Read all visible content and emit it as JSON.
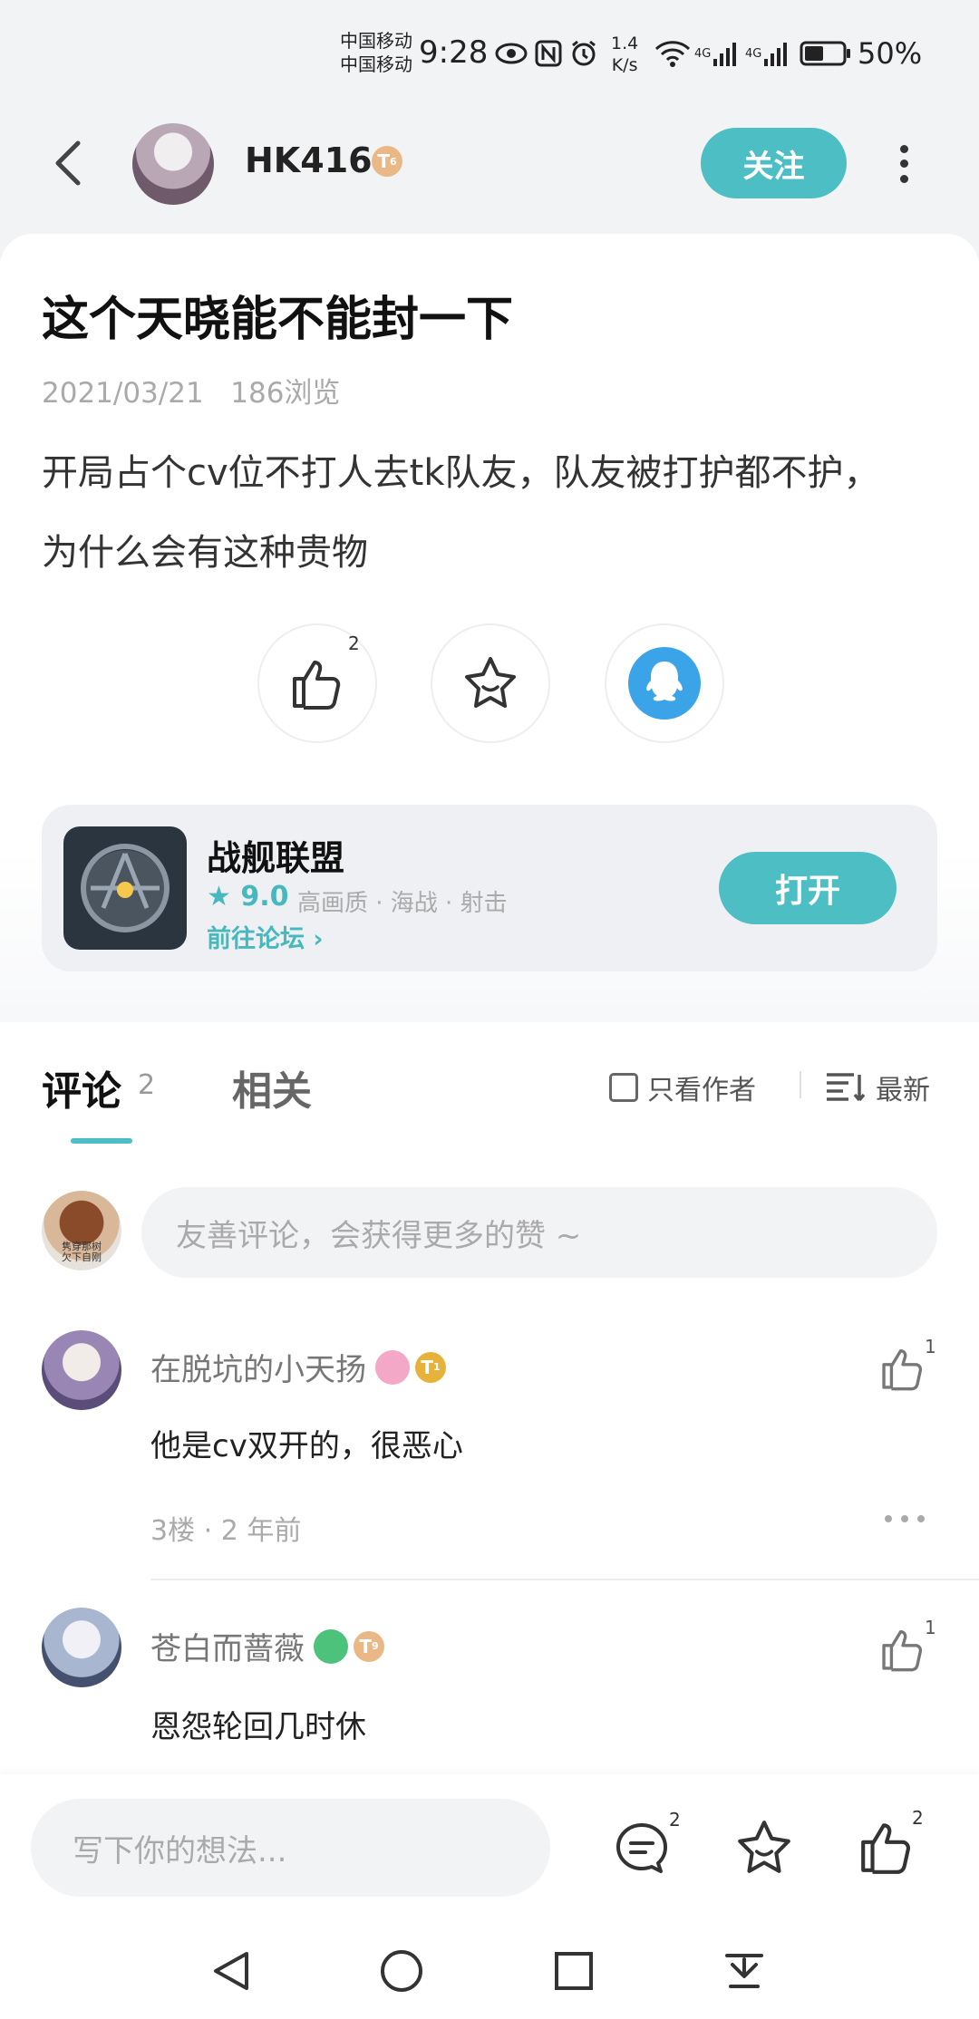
{
  "status_bar": {
    "carrier1": "中国移动",
    "carrier2": "中国移动",
    "time": "9:28",
    "speed_value": "1.4",
    "speed_unit": "K/s",
    "sim1": "4G",
    "sim2": "4G",
    "battery": "50%",
    "battery_level": 0.5
  },
  "header": {
    "username": "HK416",
    "level_badge": "T",
    "level_num": "6",
    "follow_label": "关注"
  },
  "post": {
    "title": "这个天晓能不能封一下",
    "date": "2021/03/21",
    "views": "186浏览",
    "body_line1": "开局占个cv位不打人去tk队友，队友被打护都不护，",
    "body_line2": "为什么会有这种贵物",
    "like_count": "2"
  },
  "game_card": {
    "name": "战舰联盟",
    "score": "9.0",
    "tags": "高画质 · 海战 · 射击",
    "forum_link": "前往论坛",
    "open_label": "打开"
  },
  "comments_section": {
    "tab_comments": "评论",
    "comment_count": "2",
    "tab_related": "相关",
    "only_author": "只看作者",
    "sort_label": "最新",
    "my_avatar_text1": "隽穿那树",
    "my_avatar_text2": "欠下自刚",
    "input_placeholder": "友善评论，会获得更多的赞 ~",
    "items": [
      {
        "name": "在脱坑的小天扬",
        "badge": "T",
        "badge_num": "1",
        "text": "他是cv双开的，很恶心",
        "floor_time": "3楼 · 2 年前",
        "likes": "1"
      },
      {
        "name": "苍白而蔷薇",
        "badge": "T",
        "badge_num": "9",
        "text": "恩怨轮回几时休",
        "likes": "1"
      }
    ]
  },
  "bottom_bar": {
    "placeholder": "写下你的想法...",
    "comment_count": "2",
    "like_count": "2"
  },
  "colors": {
    "accent": "#4dbfc4",
    "background": "#f2f3f5",
    "badge": "#e9b886"
  }
}
